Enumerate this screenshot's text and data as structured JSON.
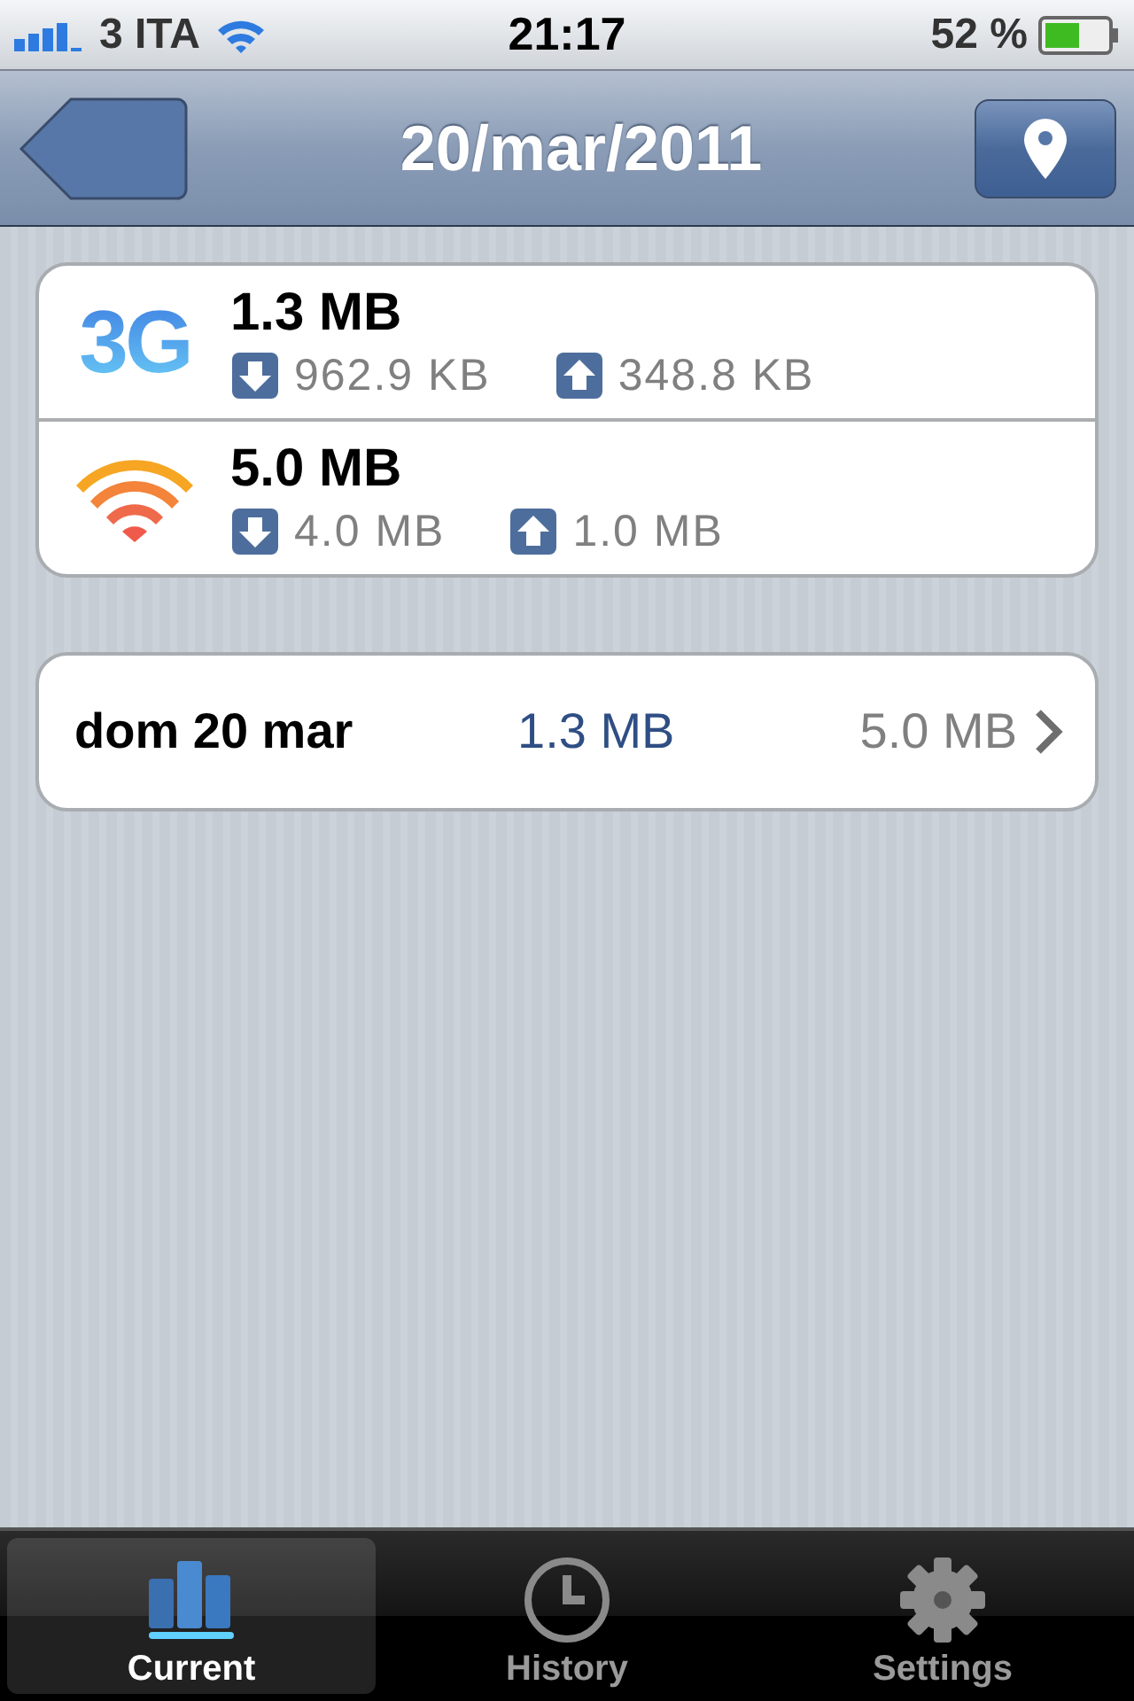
{
  "status_bar": {
    "carrier": "3 ITA",
    "time": "21:17",
    "battery": "52 %"
  },
  "nav_bar": {
    "title": "20/mar/2011"
  },
  "networks": [
    {
      "kind": "cellular",
      "logo": "3G",
      "total": "1.3 MB",
      "download": "962.9 KB",
      "upload": "348.8 KB"
    },
    {
      "kind": "wifi",
      "total": "5.0 MB",
      "download": "4.0 MB",
      "upload": "1.0 MB"
    }
  ],
  "days": [
    {
      "label": "dom 20 mar",
      "cellular": "1.3 MB",
      "wifi": "5.0 MB"
    }
  ],
  "tabs": [
    {
      "kind": "chart",
      "label": "Current",
      "selected": true
    },
    {
      "kind": "clock",
      "label": "History",
      "selected": false
    },
    {
      "kind": "gear",
      "label": "Settings",
      "selected": false
    }
  ]
}
